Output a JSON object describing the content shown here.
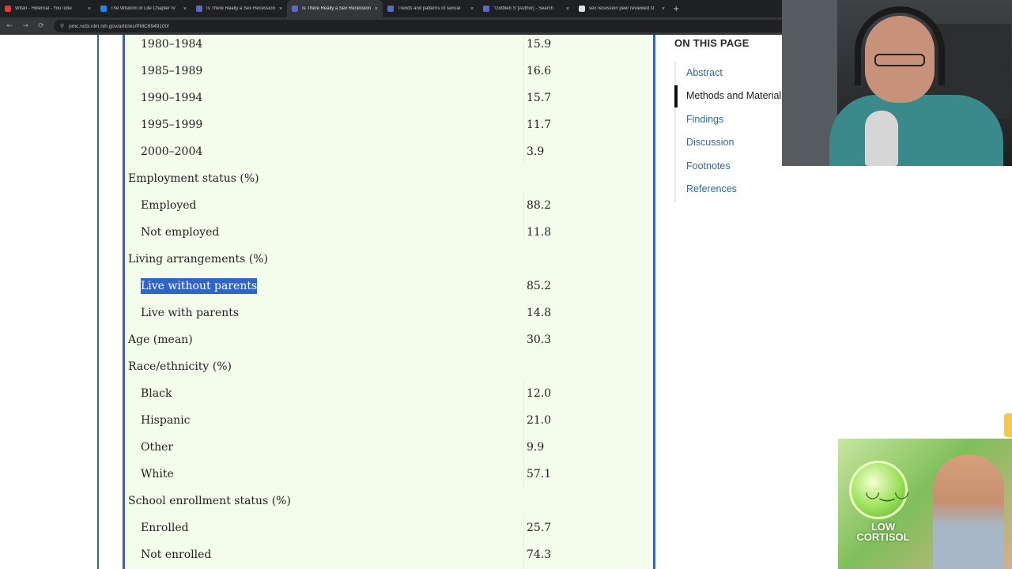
{
  "browser": {
    "tabs": [
      {
        "label": "Witan - Hibernal - YouTube",
        "active": false,
        "favicon_color": "#e53935"
      },
      {
        "label": "The Wisdom of Life Chapter IV",
        "active": false,
        "favicon_color": "#1e88e5"
      },
      {
        "label": "Is There Really a Sex Recession",
        "active": false,
        "favicon_color": "#5c6bc0"
      },
      {
        "label": "Is There Really a Sex Recession",
        "active": true,
        "favicon_color": "#5c6bc0"
      },
      {
        "label": "Trends and patterns of sexual",
        "active": false,
        "favicon_color": "#5c6bc0"
      },
      {
        "label": "\"Gottlieb S\"[Author] - Search",
        "active": false,
        "favicon_color": "#5c6bc0"
      },
      {
        "label": "sex recession peer reviewed st",
        "active": false,
        "favicon_color": "#e0e0e0"
      }
    ],
    "new_tab_glyph": "+",
    "close_glyph": "×",
    "url": "pmc.ncbi.nlm.nih.gov/articles/PMC6949100/",
    "nav": {
      "back": "←",
      "forward": "→",
      "reload": "⟳"
    }
  },
  "table": {
    "rows": [
      {
        "label": "1980–1984",
        "value": "15.9",
        "sub": true
      },
      {
        "label": "1985–1989",
        "value": "16.6",
        "sub": true
      },
      {
        "label": "1990–1994",
        "value": "15.7",
        "sub": true
      },
      {
        "label": "1995–1999",
        "value": "11.7",
        "sub": true
      },
      {
        "label": "2000–2004",
        "value": "3.9",
        "sub": true
      },
      {
        "label": "Employment status (%)",
        "value": "",
        "sub": false
      },
      {
        "label": "Employed",
        "value": "88.2",
        "sub": true
      },
      {
        "label": "Not employed",
        "value": "11.8",
        "sub": true
      },
      {
        "label": "Living arrangements (%)",
        "value": "",
        "sub": false
      },
      {
        "label": "Live without parents",
        "value": "85.2",
        "sub": true,
        "selected": true
      },
      {
        "label": "Live with parents",
        "value": "14.8",
        "sub": true
      },
      {
        "label": "Age (mean)",
        "value": "30.3",
        "sub": false
      },
      {
        "label": "Race/ethnicity (%)",
        "value": "",
        "sub": false
      },
      {
        "label": "Black",
        "value": "12.0",
        "sub": true
      },
      {
        "label": "Hispanic",
        "value": "21.0",
        "sub": true
      },
      {
        "label": "Other",
        "value": "9.9",
        "sub": true
      },
      {
        "label": "White",
        "value": "57.1",
        "sub": true
      },
      {
        "label": "School enrollment status (%)",
        "value": "",
        "sub": false
      },
      {
        "label": "Enrolled",
        "value": "25.7",
        "sub": true
      },
      {
        "label": "Not enrolled",
        "value": "74.3",
        "sub": true
      }
    ]
  },
  "toc": {
    "title": "ON THIS PAGE",
    "items": [
      {
        "label": "Abstract",
        "active": false
      },
      {
        "label": "Methods and Material",
        "active": true
      },
      {
        "label": "Findings",
        "active": false
      },
      {
        "label": "Discussion",
        "active": false
      },
      {
        "label": "Footnotes",
        "active": false
      },
      {
        "label": "References",
        "active": false
      }
    ]
  },
  "ad": {
    "line1": "LOW",
    "line2": "CORTISOL",
    "face_glyph": "◡‿◡"
  },
  "colors": {
    "accent": "#2f63c4",
    "table_bg": "#f4fcec",
    "link": "#2b6aa8",
    "selection": "#2f64c8"
  }
}
